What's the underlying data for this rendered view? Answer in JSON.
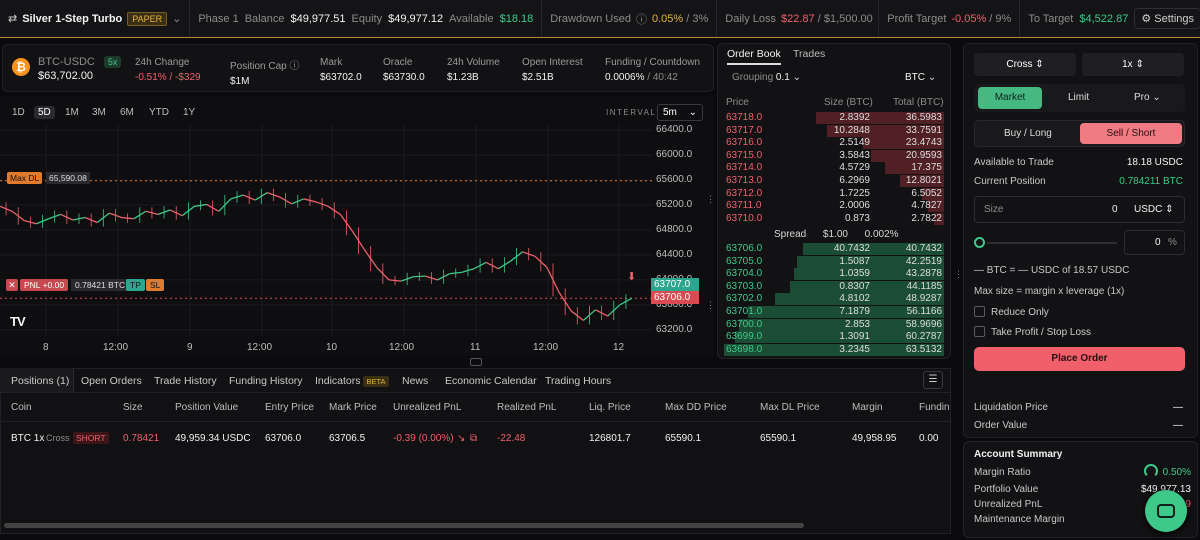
{
  "topbar": {
    "account": "Silver 1-Step Turbo",
    "badge": "PAPER",
    "phase": "Phase 1",
    "balance_label": "Balance",
    "balance": "$49,977.51",
    "equity_label": "Equity",
    "equity": "$49,977.12",
    "available_label": "Available",
    "available": "$18.18",
    "drawdown_label": "Drawdown Used",
    "drawdown_pct": "0.05%",
    "drawdown_max": "/ 3%",
    "daily_loss_label": "Daily Loss",
    "daily_loss": "$22.87",
    "daily_loss_max": "/ $1,500.00",
    "profit_target_label": "Profit Target",
    "profit_target_pct": "-0.05%",
    "profit_target_max": "/ 9%",
    "to_target_label": "To Target",
    "to_target": "$4,522.87",
    "settings": "Settings",
    "st": "St"
  },
  "ticker": {
    "symbol": "BTC-USDC",
    "leverage": "5x",
    "price": "$63,702.00",
    "change_label": "24h Change",
    "change": "-0.51% / -$329",
    "poscap_label": "Position Cap",
    "poscap": "$1M",
    "mark_label": "Mark",
    "mark": "$63702.0",
    "oracle_label": "Oracle",
    "oracle": "$63730.0",
    "volume_label": "24h Volume",
    "volume": "$1.23B",
    "oi_label": "Open Interest",
    "oi": "$2.51B",
    "funding_label": "Funding / Countdown",
    "funding": "0.0006%",
    "countdown": "/ 40:42"
  },
  "chart": {
    "timeframes": [
      "1D",
      "5D",
      "1M",
      "3M",
      "6M",
      "YTD",
      "1Y"
    ],
    "interval_label": "INTERVAL",
    "interval": "5m",
    "max_dl_label": "Max DL",
    "max_dl_value": "65,590.08",
    "pnl_label": "PNL +0.00",
    "pos_size": "0.78421 BTC",
    "tp": "TP",
    "sl": "SL",
    "price_tag_1": "63707.0",
    "price_tag_2": "63706.0",
    "logo": "TV"
  },
  "chart_data": {
    "type": "line",
    "x_ticks": [
      "8",
      "12:00",
      "9",
      "12:00",
      "10",
      "12:00",
      "11",
      "12:00",
      "12"
    ],
    "y_ticks": [
      "66400.0",
      "66000.0",
      "65600.0",
      "65200.0",
      "64800.0",
      "64400.0",
      "64000.0",
      "63600.0",
      "63200.0"
    ],
    "ylim": [
      63100,
      66500
    ],
    "series": [
      {
        "values": [
          65180,
          65100,
          64950,
          64900,
          64980,
          65050,
          64960,
          65000,
          64920,
          65070,
          65000,
          64980,
          65100,
          65050,
          65120,
          65030,
          65180,
          65210,
          65100,
          65300,
          65360,
          65280,
          65400,
          65330,
          65220,
          65300,
          65250,
          65180,
          65050,
          64780,
          64480,
          64200,
          64000,
          63980,
          64050,
          64060,
          64000,
          64100,
          64120,
          64180,
          64280,
          64180,
          64300,
          64450,
          64380,
          64200,
          63800,
          63500,
          63350,
          63520,
          63420,
          63600,
          63707
        ]
      }
    ],
    "levels": {
      "max_dl": 65590.08,
      "entry": 63706.0
    }
  },
  "orderbook": {
    "tab_orderbook": "Order Book",
    "tab_trades": "Trades",
    "grouping_label": "Grouping",
    "grouping": "0.1",
    "asset": "BTC",
    "col_price": "Price",
    "col_size": "Size (BTC)",
    "col_total": "Total (BTC)",
    "asks": [
      {
        "p": "63718.0",
        "s": "2.8392",
        "t": "36.5983",
        "d": 0.58
      },
      {
        "p": "63717.0",
        "s": "10.2848",
        "t": "33.7591",
        "d": 0.53
      },
      {
        "p": "63716.0",
        "s": "2.5149",
        "t": "23.4743",
        "d": 0.37
      },
      {
        "p": "63715.0",
        "s": "3.5843",
        "t": "20.9593",
        "d": 0.33
      },
      {
        "p": "63714.0",
        "s": "4.5729",
        "t": "17.375",
        "d": 0.27
      },
      {
        "p": "63713.0",
        "s": "6.2969",
        "t": "12.8021",
        "d": 0.2
      },
      {
        "p": "63712.0",
        "s": "1.7225",
        "t": "6.5052",
        "d": 0.1
      },
      {
        "p": "63711.0",
        "s": "2.0006",
        "t": "4.7827",
        "d": 0.075
      },
      {
        "p": "63710.0",
        "s": "0.873",
        "t": "2.7822",
        "d": 0.044
      }
    ],
    "spread_label": "Spread",
    "spread": "$1.00",
    "spread_pct": "0.002%",
    "bids": [
      {
        "p": "63706.0",
        "s": "40.7432",
        "t": "40.7432",
        "d": 0.64
      },
      {
        "p": "63705.0",
        "s": "1.5087",
        "t": "42.2519",
        "d": 0.67
      },
      {
        "p": "63704.0",
        "s": "1.0359",
        "t": "43.2878",
        "d": 0.68
      },
      {
        "p": "63703.0",
        "s": "0.8307",
        "t": "44.1185",
        "d": 0.7
      },
      {
        "p": "63702.0",
        "s": "4.8102",
        "t": "48.9287",
        "d": 0.77
      },
      {
        "p": "63701.0",
        "s": "7.1879",
        "t": "56.1166",
        "d": 0.89
      },
      {
        "p": "63700.0",
        "s": "2.853",
        "t": "58.9696",
        "d": 0.93
      },
      {
        "p": "63699.0",
        "s": "1.3091",
        "t": "60.2787",
        "d": 0.95
      },
      {
        "p": "63698.0",
        "s": "3.2345",
        "t": "63.5132",
        "d": 1.0
      }
    ]
  },
  "order": {
    "margin_mode": "Cross",
    "leverage": "1x",
    "tab_market": "Market",
    "tab_limit": "Limit",
    "tab_pro": "Pro",
    "buy": "Buy / Long",
    "sell": "Sell / Short",
    "avail_label": "Available to Trade",
    "avail": "18.18 USDC",
    "curpos_label": "Current Position",
    "curpos": "0.784211 BTC",
    "size_label": "Size",
    "size_value": "0",
    "size_unit": "USDC",
    "pct_value": "0",
    "pct_unit": "%",
    "conv": "— BTC = — USDC of 18.57 USDC",
    "maxsize": "Max size = margin x leverage (1x)",
    "reduce": "Reduce Only",
    "tpsl": "Take Profit / Stop Loss",
    "place": "Place Order",
    "liq_label": "Liquidation Price",
    "liq": "—",
    "ov_label": "Order Value",
    "ov": "—"
  },
  "summary": {
    "title": "Account Summary",
    "margin_ratio_label": "Margin Ratio",
    "margin_ratio": "0.50%",
    "portfolio_label": "Portfolio Value",
    "portfolio": "$49,977.13",
    "upnl_label": "Unrealized PnL",
    "upnl": "-0.39",
    "maint_label": "Maintenance Margin"
  },
  "positions": {
    "tabs": [
      "Positions (1)",
      "Open Orders",
      "Trade History",
      "Funding History",
      "Indicators",
      "News",
      "Economic Calendar",
      "Trading Hours"
    ],
    "beta": "BETA",
    "headers": [
      "Coin",
      "Size",
      "Position Value",
      "Entry Price",
      "Mark Price",
      "Unrealized PnL",
      "Realized PnL",
      "Liq. Price",
      "Max DD Price",
      "Max DL Price",
      "Margin",
      "Funding"
    ],
    "row": {
      "coin": "BTC 1x",
      "mode": "Cross",
      "side": "SHORT",
      "size": "0.78421",
      "value": "49,959.34 USDC",
      "entry": "63706.0",
      "mark": "63706.5",
      "upnl": "-0.39 (0.00%)",
      "rpnl": "-22.48",
      "liq": "126801.7",
      "maxdd": "65590.1",
      "maxdl": "65590.1",
      "margin": "49,958.95",
      "funding": "0.00"
    }
  },
  "colors": {
    "green": "#3ec98a",
    "red": "#f0606b",
    "accent_gold": "#b78a3c",
    "sell_pink": "#f07b83"
  }
}
